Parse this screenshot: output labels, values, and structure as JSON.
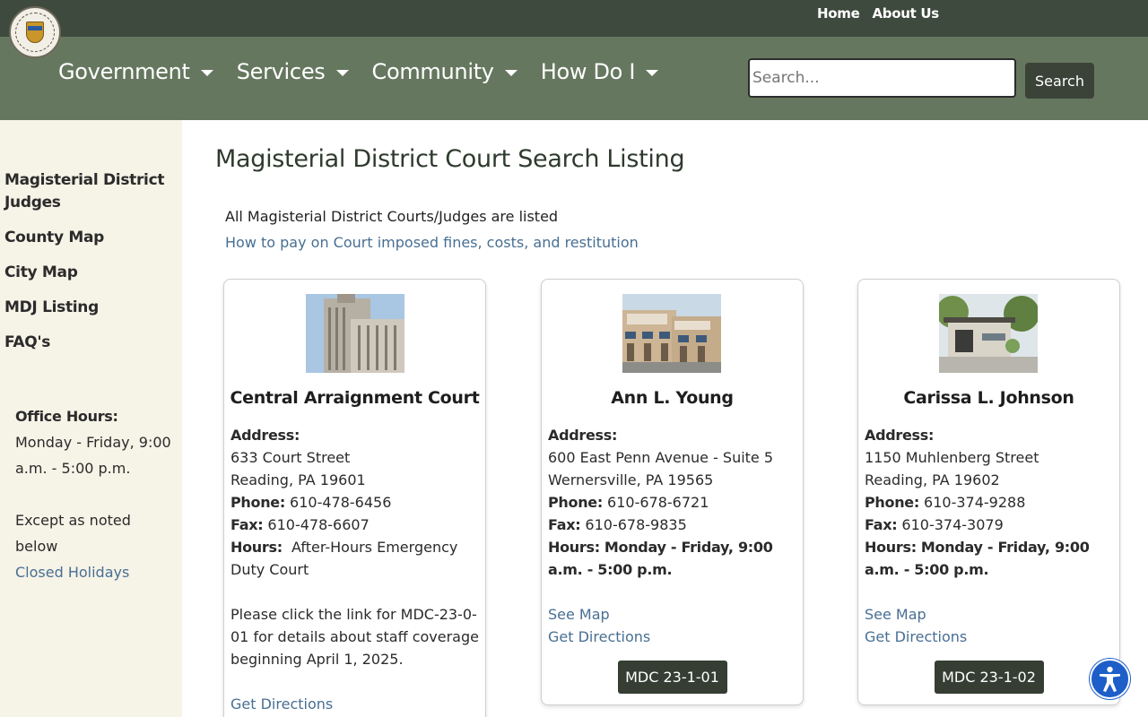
{
  "header": {
    "top_links": [
      "Home",
      "About Us"
    ],
    "nav": [
      "Government",
      "Services",
      "Community",
      "How Do I"
    ],
    "search": {
      "placeholder": "Search...",
      "button": "Search"
    }
  },
  "sidebar": {
    "links": [
      "Magisterial District Judges",
      "County Map",
      "City Map",
      "MDJ Listing",
      "FAQ's"
    ],
    "office_hours_title": "Office Hours:",
    "office_hours_text": "Monday - Friday, 9:00 a.m. - 5:00 p.m.",
    "except_text": "Except as noted below",
    "holidays_link": "Closed Holidays"
  },
  "main": {
    "title": "Magisterial District Court Search Listing",
    "intro": "All Magisterial District Courts/Judges are listed",
    "fines_link": "How to pay on Court imposed fines, costs, and restitution"
  },
  "labels": {
    "address": "Address:",
    "phone": "Phone:",
    "fax": "Fax:",
    "hours": "Hours:",
    "see_map": "See Map",
    "directions": "Get Directions"
  },
  "cards": [
    {
      "name": "Central Arraignment Court",
      "street": "633 Court Street",
      "city": "Reading, PA 19601",
      "phone": "610-478-6456",
      "fax": "610-478-6607",
      "hours": "After-Hours Emergency Duty Court",
      "note": "Please click the link for MDC-23-0-01 for details about staff coverage beginning April 1, 2025."
    },
    {
      "name": "Ann L. Young",
      "street": "600 East Penn Avenue - Suite 5",
      "city": "Wernersville, PA 19565",
      "phone": "610-678-6721",
      "fax": "610-678-9835",
      "hours": "Monday - Friday, 9:00 a.m. - 5:00 p.m.",
      "button": "MDC 23-1-01"
    },
    {
      "name": "Carissa L. Johnson",
      "street": "1150 Muhlenberg Street",
      "city": "Reading, PA 19602",
      "phone": "610-374-9288",
      "fax": "610-374-3079",
      "hours": "Monday - Friday, 9:00 a.m. - 5:00 p.m.",
      "button": "MDC 23-1-02"
    }
  ],
  "icons": {
    "seal": "county-seal-icon",
    "accessibility": "accessibility-icon"
  },
  "colors": {
    "topbar": "#3f4a3e",
    "navbar": "#66775f",
    "sidebar": "#f6f3e7",
    "link": "#486f93",
    "button": "#363e34",
    "accessibility": "#1d5ec9"
  }
}
